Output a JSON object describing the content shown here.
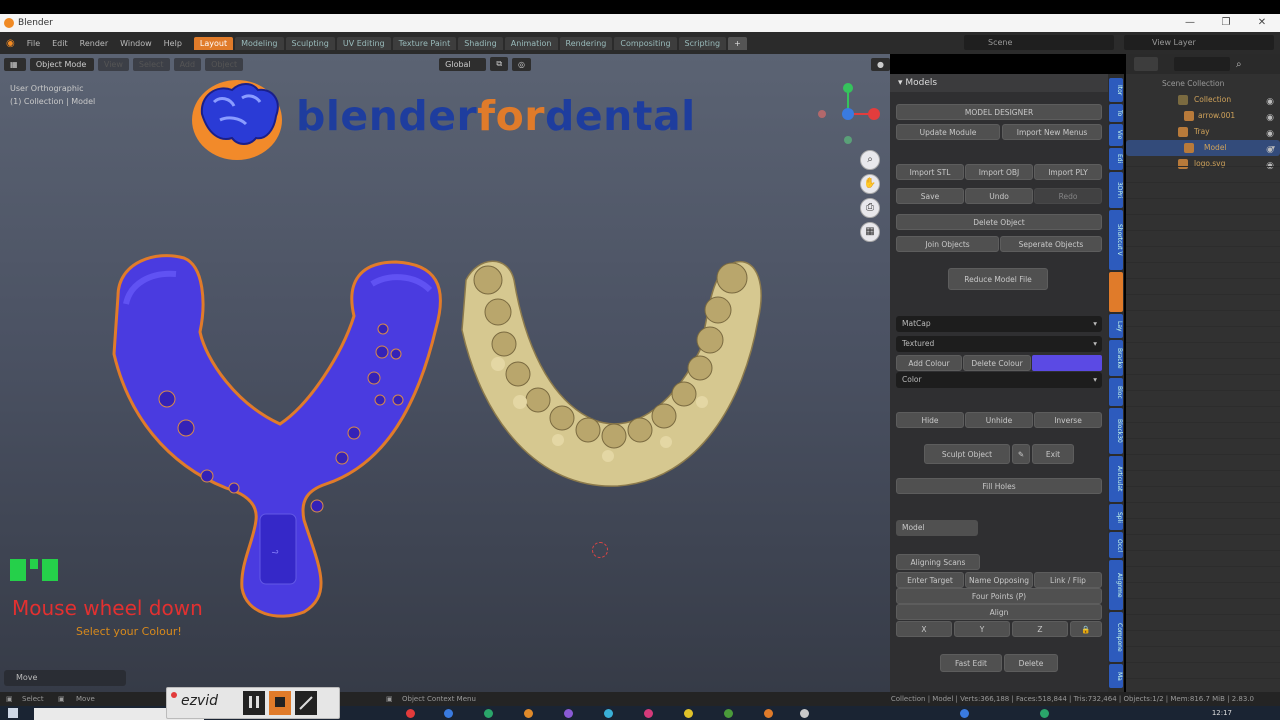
{
  "window": {
    "title": "Blender",
    "controls": [
      "—",
      "❐",
      "✕"
    ]
  },
  "menubar": {
    "items": [
      "File",
      "Edit",
      "Render",
      "Window",
      "Help"
    ]
  },
  "workspaces": [
    {
      "label": "Layout",
      "active": true
    },
    {
      "label": "Modeling"
    },
    {
      "label": "Sculpting"
    },
    {
      "label": "UV Editing"
    },
    {
      "label": "Texture Paint"
    },
    {
      "label": "Shading"
    },
    {
      "label": "Animation"
    },
    {
      "label": "Rendering"
    },
    {
      "label": "Compositing"
    },
    {
      "label": "Scripting"
    },
    {
      "label": "+"
    }
  ],
  "scene": {
    "label": "Scene"
  },
  "view_layer": {
    "label": "View Layer"
  },
  "viewport": {
    "mode": "Object Mode",
    "menus": [
      "View",
      "Select",
      "Add",
      "Object"
    ],
    "orientation": "Global",
    "info_line1": "User Orthographic",
    "info_line2": "(1) Collection | Model",
    "brand": {
      "part1": "blender",
      "part2": "for",
      "part3": "dental",
      "blue": "#1e3d9e",
      "orange": "#e07b2a"
    },
    "gizmo_axes": {
      "x": "#e23d3d",
      "y": "#35c35c",
      "z": "#3a7be0"
    },
    "nav_icons": [
      "zoom-icon",
      "pan-icon",
      "camera-icon",
      "grid-icon"
    ],
    "keys_overlay": "Mouse wheel down",
    "hint": "Select your Colour!",
    "last_op": "Move"
  },
  "npanel": {
    "header": "Models",
    "model_designer": "MODEL DESIGNER",
    "update_module": "Update Module",
    "import_new_menus": "Import New Menus",
    "import_stl": "Import STL",
    "import_obj": "Import OBJ",
    "import_ply": "Import PLY",
    "save": "Save",
    "undo": "Undo",
    "redo": "Redo",
    "delete_object": "Delete Object",
    "join_objects": "Join Objects",
    "seperate_objects": "Seperate Objects",
    "reduce_model_file": "Reduce Model File",
    "matcap": "MatCap",
    "textured": "Textured",
    "add_colour": "Add Colour",
    "delete_colour": "Delete Colour",
    "swatch_color": "#5b4ae4",
    "color": "Color",
    "hide": "Hide",
    "unhide": "Unhide",
    "inverse": "Inverse",
    "sculpt_object": "Sculpt Object",
    "exit": "Exit",
    "fill_holes": "Fill Holes",
    "model_name": "Model",
    "aligning_scans": "Aligning Scans",
    "enter_target": "Enter Target",
    "name_opposing": "Name Opposing",
    "link_flip": "Link / Flip",
    "four_points": "Four Points (P)",
    "align": "Align",
    "axis_x": "X",
    "axis_y": "Y",
    "axis_z": "Z",
    "fast_edit": "Fast Edit",
    "delete": "Delete"
  },
  "side_tabs": [
    "Itor",
    "To",
    "Vie",
    "Edi",
    "3DPri",
    "Shortcut V",
    "",
    "Lay",
    "Bracke",
    "Bloc",
    "Block30",
    "Articulat",
    "Spli",
    "Occl",
    "Alignme",
    "Compone",
    "Ma"
  ],
  "outliner": {
    "rows": [
      {
        "label": "Scene Collection",
        "color": "#bbbbbb"
      },
      {
        "label": "Collection",
        "color": "#cfa25a"
      },
      {
        "label": "arrow.001",
        "color": "#cfa25a"
      },
      {
        "label": "Tray",
        "color": "#cfa25a"
      },
      {
        "label": "Model",
        "color": "#cfa25a",
        "selected": true
      },
      {
        "label": "logo.svg",
        "color": "#cfa25a"
      }
    ]
  },
  "statusbar": {
    "left1": "Select",
    "left2": "Move",
    "mid": "Object Context Menu",
    "right": "Collection | Model | Verts:366,188 | Faces:518,844 | Tris:732,464 | Objects:1/2 | Mem:816.7 MiB | 2.83.0"
  },
  "ezvid": {
    "brand": "ezvid"
  },
  "taskbar": {
    "time": "12:17"
  }
}
